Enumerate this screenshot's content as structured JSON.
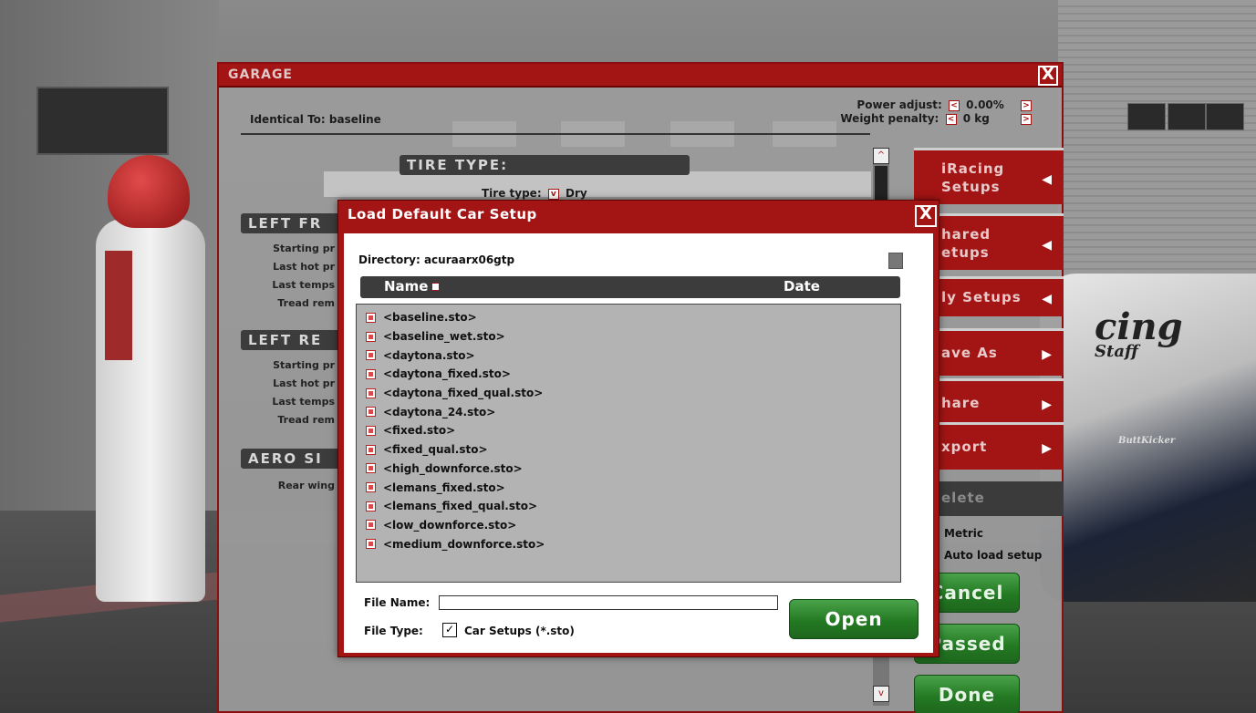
{
  "background": {
    "car_brand_1": "cing",
    "car_brand_2": "Staff",
    "car_brand_3": "ButtKicker"
  },
  "garage": {
    "title": "GARAGE",
    "close_glyph": "X",
    "identical_to": "Identical To: baseline",
    "power_adjust_label": "Power adjust:",
    "power_adjust_value": "0.00%",
    "weight_penalty_label": "Weight penalty:",
    "weight_penalty_value": "0 kg",
    "sections": {
      "tire_type": "TIRE TYPE:",
      "left_front": "LEFT FR",
      "left_rear": "LEFT RE",
      "aero": "AERO SI"
    },
    "tire_type_label": "Tire type:",
    "tire_type_value": "Dry",
    "left_front_rows": [
      "Starting pr",
      "Last hot pr",
      "Last temps",
      "Tread rem"
    ],
    "left_rear_rows": [
      "Starting pr",
      "Last hot pr",
      "Last temps",
      "Tread rem"
    ],
    "aero_rows": [
      "Rear wing"
    ]
  },
  "side_menu": {
    "iracing_setups": "iRacing Setups",
    "shared_setups": "hared etups",
    "my_setups": "ly Setups",
    "save_as": "ave As",
    "share": "hare",
    "export": "xport",
    "delete": "elete",
    "metric": "Metric",
    "auto_load": "Auto load setup",
    "cancel": "Cancel",
    "passed": "Passed",
    "done": "Done"
  },
  "dialog": {
    "title": "Load Default Car Setup",
    "close_glyph": "X",
    "directory_label": "Directory:",
    "directory_value": "acuraarx06gtp",
    "col_name": "Name",
    "col_date": "Date",
    "files": [
      "<baseline.sto>",
      "<baseline_wet.sto>",
      "<daytona.sto>",
      "<daytona_fixed.sto>",
      "<daytona_fixed_qual.sto>",
      "<daytona_24.sto>",
      "<fixed.sto>",
      "<fixed_qual.sto>",
      "<high_downforce.sto>",
      "<lemans_fixed.sto>",
      "<lemans_fixed_qual.sto>",
      "<low_downforce.sto>",
      "<medium_downforce.sto>"
    ],
    "file_name_label": "File Name:",
    "file_name_value": "",
    "file_type_label": "File Type:",
    "file_type_value": "Car Setups (*.sto)",
    "open_button": "Open"
  },
  "colors": {
    "accent_red": "#a31414",
    "green": "#237a23",
    "dark_bar": "#3c3c3c"
  }
}
